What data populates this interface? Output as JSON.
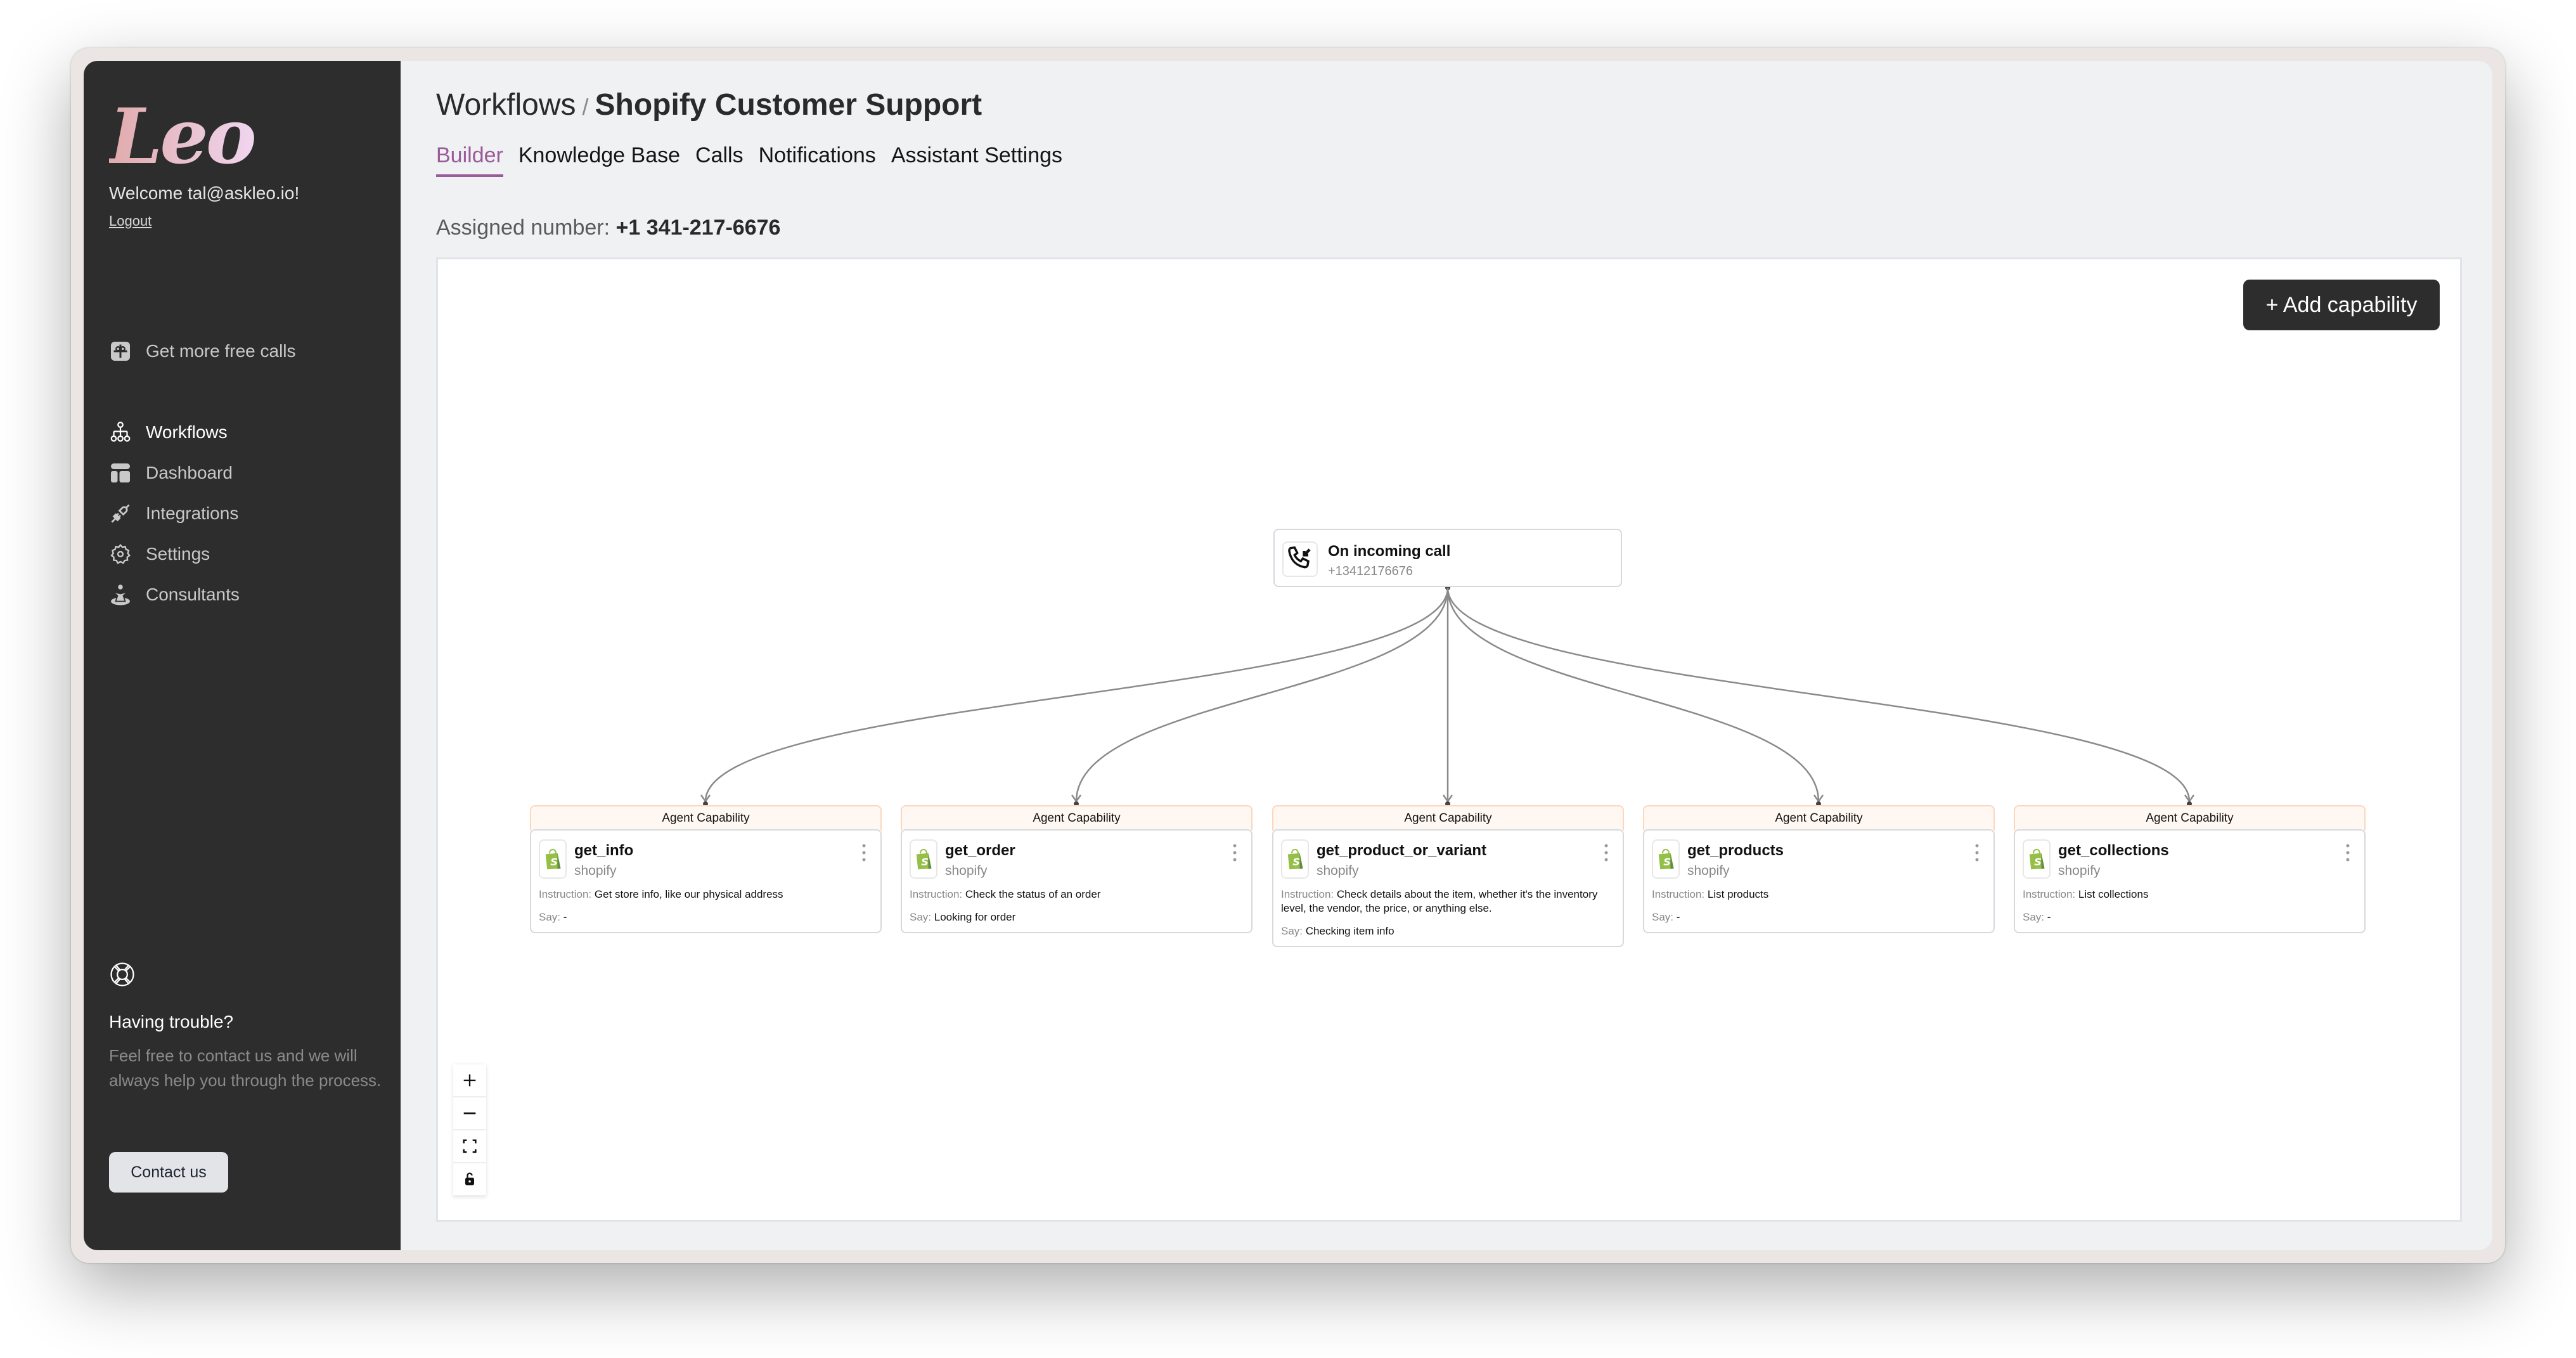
{
  "sidebar": {
    "logo": "Leo",
    "welcome": "Welcome tal@askleo.io!",
    "logout": "Logout",
    "promo": {
      "label": "Get more free calls",
      "icon": "gift-icon"
    },
    "items": [
      {
        "label": "Workflows",
        "icon": "workflow-tree-icon",
        "active": true
      },
      {
        "label": "Dashboard",
        "icon": "dashboard-layout-icon",
        "active": false
      },
      {
        "label": "Integrations",
        "icon": "plug-icon",
        "active": false
      },
      {
        "label": "Settings",
        "icon": "gear-icon",
        "active": false
      },
      {
        "label": "Consultants",
        "icon": "person-icon",
        "active": false
      }
    ],
    "help": {
      "icon": "lifebuoy-icon",
      "title": "Having trouble?",
      "text": "Feel free to contact us and we will always help you through the process.",
      "button": "Contact us"
    }
  },
  "header": {
    "breadcrumb_root": "Workflows",
    "breadcrumb_sep": "/",
    "breadcrumb_current": "Shopify Customer Support",
    "tabs": [
      {
        "label": "Builder",
        "active": true
      },
      {
        "label": "Knowledge Base",
        "active": false
      },
      {
        "label": "Calls",
        "active": false
      },
      {
        "label": "Notifications",
        "active": false
      },
      {
        "label": "Assistant Settings",
        "active": false
      }
    ],
    "assigned_label": "Assigned number:",
    "assigned_number": "+1 341-217-6676"
  },
  "canvas": {
    "add_button": "+ Add capability",
    "trigger": {
      "title": "On incoming call",
      "subtitle": "+13412176676",
      "icon": "incoming-call-icon"
    },
    "capability_header": "Agent Capability",
    "instruction_label": "Instruction:",
    "say_label": "Say:",
    "nodes": [
      {
        "name": "get_info",
        "provider": "shopify",
        "instruction": "Get store info, like our physical address",
        "say": "-"
      },
      {
        "name": "get_order",
        "provider": "shopify",
        "instruction": "Check the status of an order",
        "say": "Looking for order"
      },
      {
        "name": "get_product_or_variant",
        "provider": "shopify",
        "instruction": "Check details about the item, whether it's the inventory level, the vendor, the price, or anything else.",
        "say": "Checking item info"
      },
      {
        "name": "get_products",
        "provider": "shopify",
        "instruction": "List products",
        "say": "-"
      },
      {
        "name": "get_collections",
        "provider": "shopify",
        "instruction": "List collections",
        "say": "-"
      }
    ],
    "zoom_controls": [
      "zoom-in-icon",
      "zoom-out-icon",
      "fit-view-icon",
      "unlock-icon"
    ]
  },
  "colors": {
    "sidebar_bg": "#2d2d2d",
    "accent": "#9b5a98",
    "capability_header_bg": "#fff8f2",
    "capability_header_border": "#fcd6bd",
    "shopify_green": "#95bf47"
  }
}
